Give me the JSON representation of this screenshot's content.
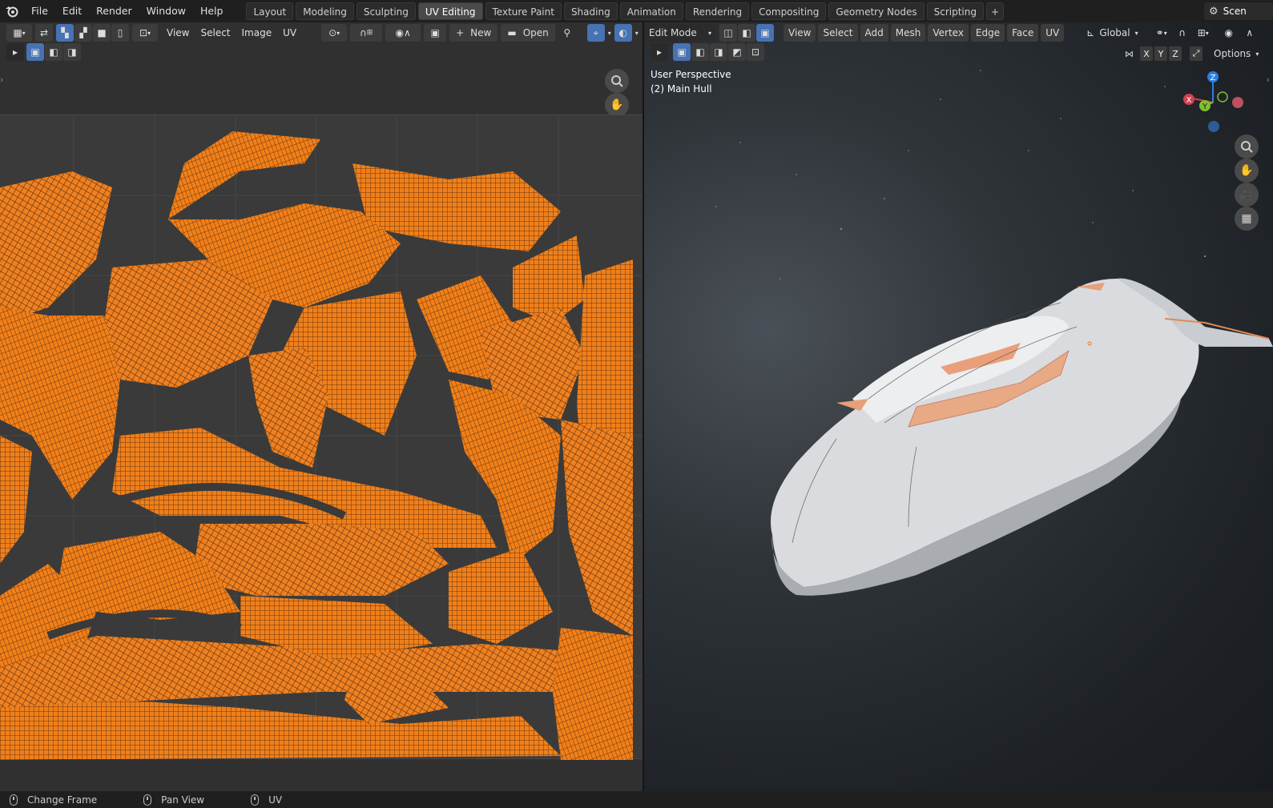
{
  "menubar": {
    "items": [
      "File",
      "Edit",
      "Render",
      "Window",
      "Help"
    ]
  },
  "workspaces": {
    "tabs": [
      "Layout",
      "Modeling",
      "Sculpting",
      "UV Editing",
      "Texture Paint",
      "Shading",
      "Animation",
      "Rendering",
      "Compositing",
      "Geometry Nodes",
      "Scripting"
    ],
    "active": "UV Editing",
    "add_label": "+"
  },
  "scene": {
    "label": "Scen"
  },
  "uv_editor": {
    "menus": [
      "View",
      "Select",
      "Image",
      "UV"
    ],
    "new_label": "New",
    "open_label": "Open"
  },
  "viewport": {
    "mode": "Edit Mode",
    "menus": [
      "View",
      "Select",
      "Add",
      "Mesh",
      "Vertex",
      "Edge",
      "Face",
      "UV"
    ],
    "orientation": "Global",
    "axes": [
      "X",
      "Y",
      "Z"
    ],
    "options_label": "Options",
    "perspective": "User Perspective",
    "object": "(2) Main Hull",
    "gizmo": {
      "x": "X",
      "y": "Y",
      "z": "Z"
    }
  },
  "statusbar": {
    "items": [
      "Change Frame",
      "Pan View",
      "UV"
    ]
  },
  "colors": {
    "accent": "#4772b3",
    "uv_mesh": "#f07f1a",
    "background": "#303030"
  }
}
